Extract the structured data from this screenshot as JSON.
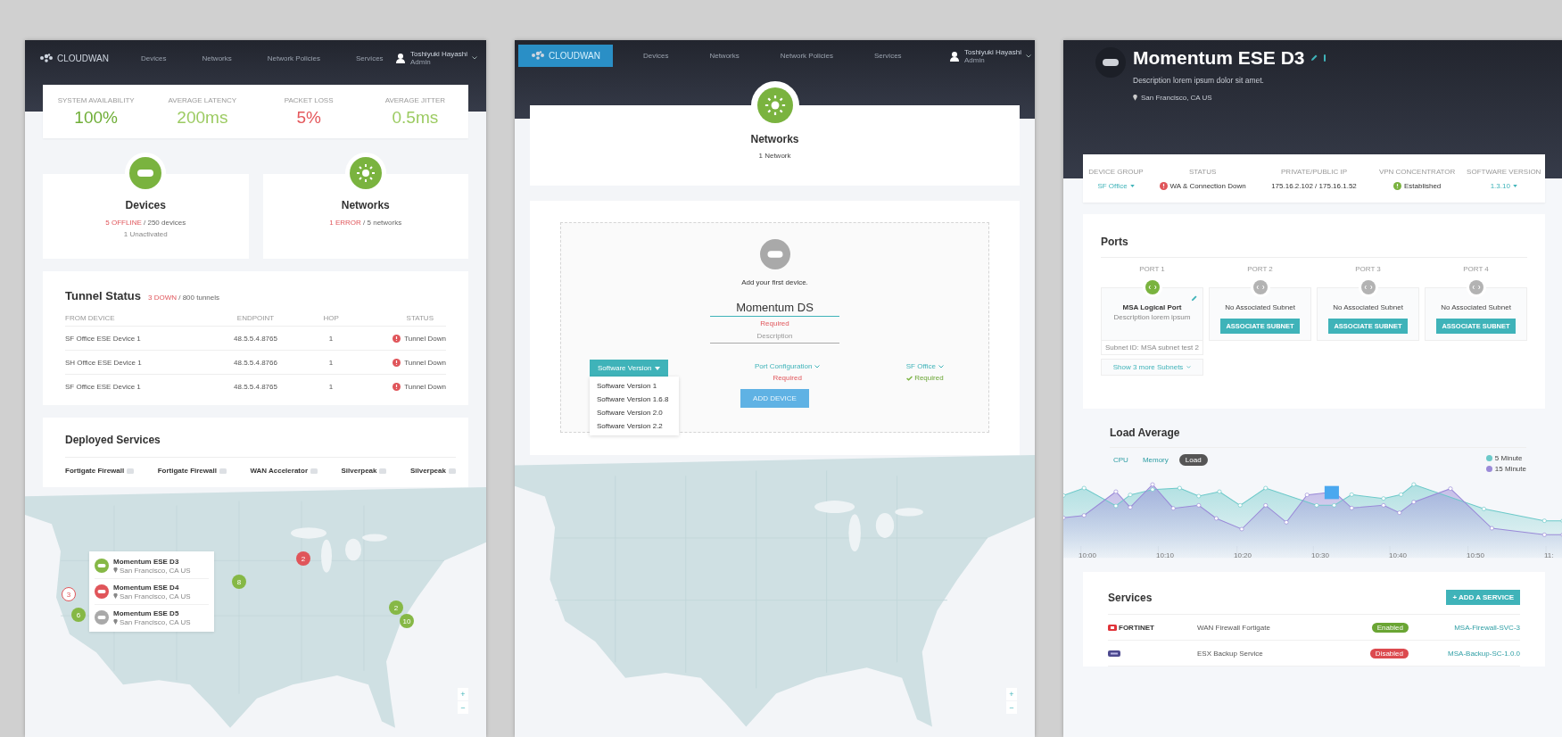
{
  "dashboard": {
    "nav": {
      "logo": "CLOUDWAN",
      "logo_highlighted": false,
      "items": [
        "Devices",
        "Networks",
        "Network Policies",
        "Services"
      ],
      "user_name": "Toshiyuki Hayashi",
      "user_role": "Admin"
    },
    "stats": [
      {
        "label": "SYSTEM AVAILABILITY",
        "value": "100%",
        "color": "#6fae37"
      },
      {
        "label": "AVERAGE LATENCY",
        "value": "200ms",
        "color": "#9ccb62"
      },
      {
        "label": "PACKET LOSS",
        "value": "5%",
        "color": "#e4585c"
      },
      {
        "label": "AVERAGE JITTER",
        "value": "0.5ms",
        "color": "#9ccb62"
      }
    ],
    "summary_cards": [
      {
        "kind": "devices",
        "title": "Devices",
        "alert": "5 OFFLINE",
        "total": "/ 250 devices",
        "note": "1 Unactivated"
      },
      {
        "kind": "networks",
        "title": "Networks",
        "alert": "1 ERROR",
        "total": "/ 5 networks"
      }
    ],
    "tunnel_status": {
      "title": "Tunnel Status",
      "alert": "3 DOWN",
      "total": "/ 800 tunnels",
      "columns": [
        "FROM DEVICE",
        "ENDPOINT",
        "HOP",
        "STATUS"
      ],
      "rows": [
        {
          "device": "SF Office ESE Device 1",
          "endpoint": "48.5.5.4.8765",
          "hop": "1",
          "status": "Tunnel Down"
        },
        {
          "device": "SH Office ESE Device 1",
          "endpoint": "48.5.5.4.8766",
          "hop": "1",
          "status": "Tunnel Down"
        },
        {
          "device": "SF Office ESE Device 1",
          "endpoint": "48.5.5.4.8765",
          "hop": "1",
          "status": "Tunnel Down"
        }
      ]
    },
    "deployed_services": {
      "title": "Deployed Services",
      "items": [
        "Fortigate Firewall",
        "Fortigate Firewall",
        "WAN Accelerator",
        "Silverpeak",
        "Silverpeak"
      ]
    },
    "map": {
      "markers": [
        {
          "label": "3",
          "color": "#e0555a",
          "selected": true
        },
        {
          "label": "6",
          "color": "#86b846",
          "selected": false
        },
        {
          "label": "8",
          "color": "#86b846",
          "selected": false
        },
        {
          "label": "2",
          "color": "#e0555a",
          "selected": false
        },
        {
          "label": "2",
          "color": "#86b846",
          "selected": false
        },
        {
          "label": "10",
          "color": "#86b846",
          "selected": false
        }
      ],
      "popup": [
        {
          "name": "Momentum ESE D3",
          "location": "San Francisco, CA US",
          "color": "#86b846"
        },
        {
          "name": "Momentum ESE D4",
          "location": "San Francisco, CA US",
          "color": "#e0555a"
        },
        {
          "name": "Momentum ESE D5",
          "location": "San Francisco, CA US",
          "color": "#a9a9a9"
        }
      ],
      "zoom_in": "+",
      "zoom_out": "−"
    }
  },
  "network_page": {
    "nav": {
      "logo": "CLOUDWAN",
      "logo_highlighted": true,
      "items": [
        "Devices",
        "Networks",
        "Network Policies",
        "Services"
      ],
      "user_name": "Toshiyuki Hayashi",
      "user_role": "Admin"
    },
    "header": {
      "title": "Networks",
      "subtitle": "1 Network"
    },
    "add_device": {
      "prompt": "Add your first device.",
      "name_value": "Momentum DS",
      "name_error": "Required",
      "description_placeholder": "Description",
      "software_version": {
        "label": "Software Version",
        "expanded": true,
        "options": [
          "Software Version 1",
          "Software Version 1.6.8",
          "Software Version 2.0",
          "Software Version 2.2"
        ]
      },
      "port_configuration": {
        "label": "Port Configuration",
        "validation": "Required",
        "valid": false
      },
      "group": {
        "label": "SF Office",
        "validation": "Required",
        "valid": true
      },
      "button": {
        "label": "ADD DEVICE",
        "disabled": true
      }
    },
    "map": {
      "zoom_in": "+",
      "zoom_out": "−"
    }
  },
  "device_page": {
    "title": "Momentum ESE D3",
    "description": "Description lorem ipsum dolor sit amet.",
    "location": "San Francisco, CA US",
    "details": [
      {
        "label": "DEVICE GROUP",
        "value": "SF Office",
        "kind": "dropdown"
      },
      {
        "label": "STATUS",
        "value": "WA & Connection Down",
        "kind": "status",
        "color": "#e0555a"
      },
      {
        "label": "PRIVATE/PUBLIC IP",
        "value": "175.16.2.102 / 175.16.1.52",
        "kind": "text"
      },
      {
        "label": "VPN CONCENTRATOR",
        "value": "Established",
        "kind": "status",
        "color": "#7ab33f"
      },
      {
        "label": "SOFTWARE VERSION",
        "value": "1.3.10",
        "kind": "dropdown"
      }
    ],
    "ports": {
      "title": "Ports",
      "items": [
        {
          "label": "PORT 1",
          "kind": "assigned",
          "active": true,
          "name": "MSA Logical Port",
          "description": "Description lorem ipsum",
          "subnet": "Subnet ID: MSA subnet test 2",
          "more": "Show 3 more Subnets"
        },
        {
          "label": "PORT 2",
          "kind": "empty",
          "active": false,
          "message": "No Associated Subnet",
          "action": "ASSOCIATE SUBNET"
        },
        {
          "label": "PORT 3",
          "kind": "empty",
          "active": false,
          "message": "No Associated Subnet",
          "action": "ASSOCIATE SUBNET"
        },
        {
          "label": "PORT 4",
          "kind": "empty",
          "active": false,
          "message": "No Associated Subnet",
          "action": "ASSOCIATE SUBNET"
        }
      ]
    },
    "load_average": {
      "title": "Load Average",
      "tabs": [
        {
          "label": "CPU",
          "selected": false
        },
        {
          "label": "Memory",
          "selected": false
        },
        {
          "label": "Load",
          "selected": true
        }
      ],
      "legend": [
        {
          "label": "5 Minute",
          "color": "#6cc9c9"
        },
        {
          "label": "15 Minute",
          "color": "#9a8ad8"
        }
      ],
      "time_labels": [
        "10:00",
        "10:10",
        "10:20",
        "10:30",
        "10:40",
        "10:50",
        "11:"
      ]
    },
    "services": {
      "title": "Services",
      "add_button": "+ ADD A SERVICE",
      "rows": [
        {
          "kind": "fortinet",
          "vendor": "FORTINET",
          "name": "WAN Firewall Fortigate",
          "status": "Enabled",
          "enabled": true,
          "link": "MSA-Firewall-SVC-3"
        },
        {
          "kind": "emc",
          "name": "ESX Backup Service",
          "status": "Disabled",
          "enabled": false,
          "link": "MSA-Backup-SC-1.0.0"
        }
      ]
    }
  }
}
